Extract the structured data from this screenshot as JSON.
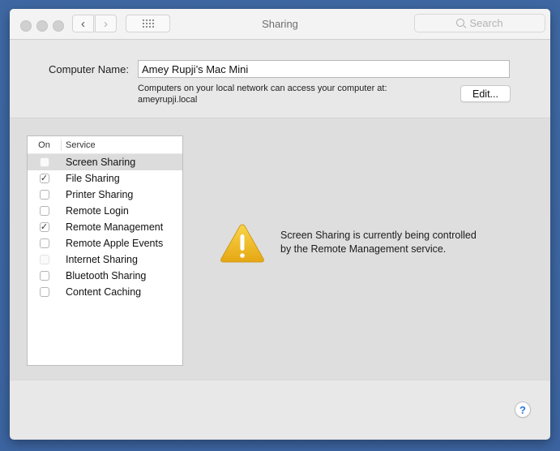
{
  "window": {
    "title": "Sharing",
    "search_placeholder": "Search"
  },
  "toolbar": {
    "back_icon": "‹",
    "forward_icon": "›"
  },
  "computer_name": {
    "label": "Computer Name:",
    "value": "Amey Rupji’s Mac Mini",
    "info_line1": "Computers on your local network can access your computer at:",
    "info_line2": "ameyrupji.local",
    "edit_label": "Edit..."
  },
  "services": {
    "header_on": "On",
    "header_service": "Service",
    "items": [
      {
        "name": "Screen Sharing",
        "checked": false,
        "enabled": false,
        "selected": true
      },
      {
        "name": "File Sharing",
        "checked": true,
        "enabled": true,
        "selected": false
      },
      {
        "name": "Printer Sharing",
        "checked": false,
        "enabled": true,
        "selected": false
      },
      {
        "name": "Remote Login",
        "checked": false,
        "enabled": true,
        "selected": false
      },
      {
        "name": "Remote Management",
        "checked": true,
        "enabled": true,
        "selected": false
      },
      {
        "name": "Remote Apple Events",
        "checked": false,
        "enabled": true,
        "selected": false
      },
      {
        "name": "Internet Sharing",
        "checked": false,
        "enabled": false,
        "selected": false
      },
      {
        "name": "Bluetooth Sharing",
        "checked": false,
        "enabled": true,
        "selected": false
      },
      {
        "name": "Content Caching",
        "checked": false,
        "enabled": true,
        "selected": false
      }
    ]
  },
  "detail": {
    "icon": "warning-icon",
    "message_line1": "Screen Sharing is currently being controlled",
    "message_line2": "by the Remote Management service."
  },
  "help": {
    "label": "?"
  },
  "colors": {
    "help_accent": "#2b73e0",
    "warning_yellow": "#f2c230"
  }
}
